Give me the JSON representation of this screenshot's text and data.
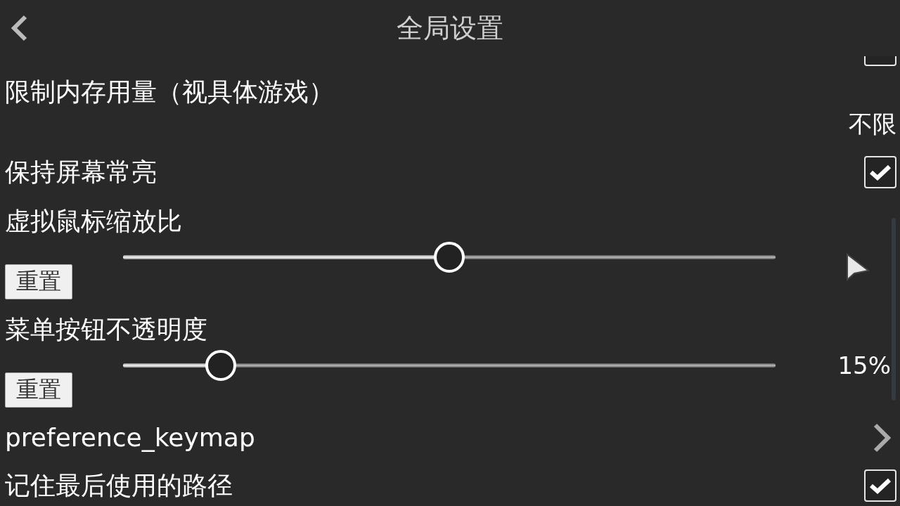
{
  "header": {
    "title": "全局设置"
  },
  "settings": [
    {
      "kind": "checkbox",
      "checked": false
    },
    {
      "kind": "value",
      "label": "限制内存用量（视具体游戏）",
      "value": "不限"
    },
    {
      "kind": "checkbox",
      "label": "保持屏幕常亮",
      "checked": true
    },
    {
      "kind": "slider",
      "label": "虚拟鼠标缩放比",
      "level": 0.5,
      "reset": "重置"
    },
    {
      "kind": "slider",
      "label": " 菜单按钮不透明度",
      "level": 0.15,
      "reading": "15%",
      "reset": "重置"
    },
    {
      "kind": "link",
      "label": "preference_keymap"
    },
    {
      "kind": "checkbox",
      "label": "记住最后使用的路径",
      "checked": true
    }
  ]
}
